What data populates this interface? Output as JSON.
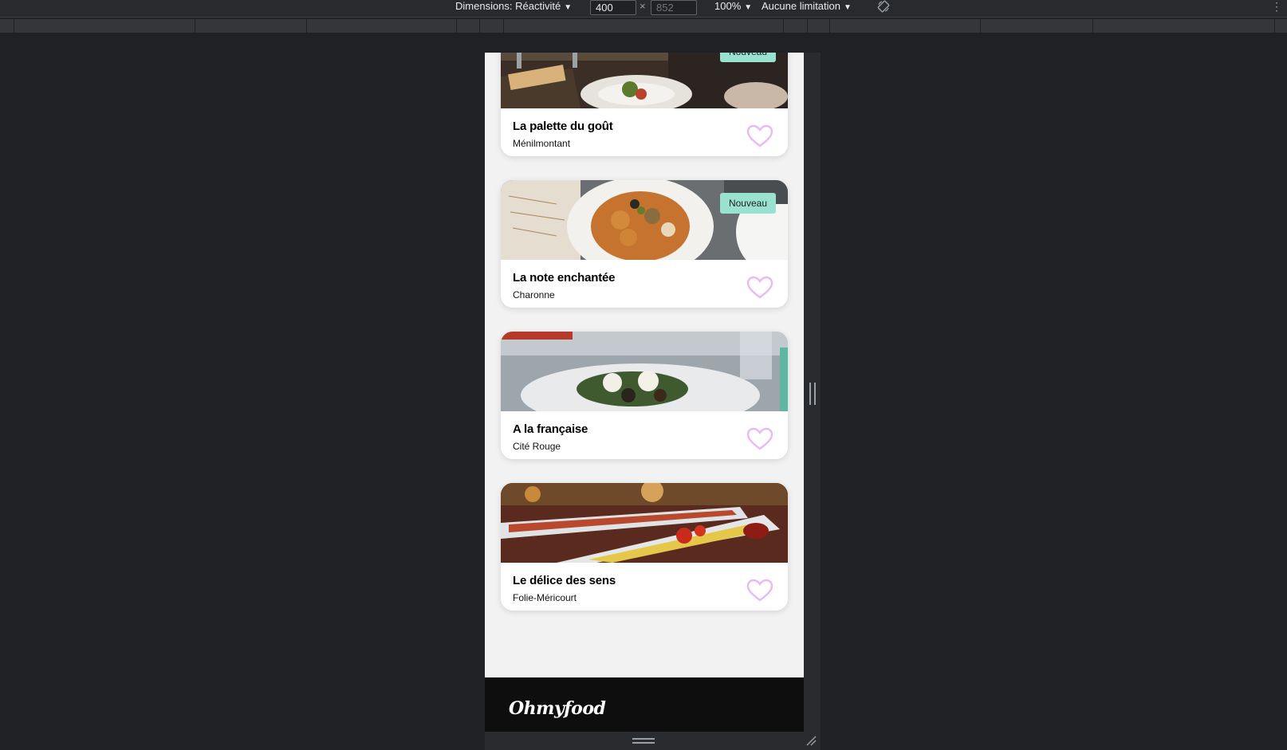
{
  "toolbar": {
    "dimensions_label": "Dimensions: Réactivité",
    "width_value": "400",
    "height_placeholder": "852",
    "times": "×",
    "zoom": "100%",
    "throttle": "Aucune limitation",
    "caret": "▼",
    "more": "⋮",
    "rotate_icon": "rotate-icon"
  },
  "restaurants": [
    {
      "name": "La palette du goût",
      "area": "Ménilmontant",
      "badge": "Nouveau"
    },
    {
      "name": "La note enchantée",
      "area": "Charonne",
      "badge": "Nouveau"
    },
    {
      "name": "A la française",
      "area": "Cité Rouge"
    },
    {
      "name": "Le délice des sens",
      "area": "Folie-Méricourt"
    }
  ],
  "footer": {
    "logo": "Ohmyfood"
  },
  "colors": {
    "badge": "#99e2d0",
    "heart": "#e9b8f5",
    "footer": "#0e0e0e",
    "page_bg": "#f2f2f2"
  }
}
